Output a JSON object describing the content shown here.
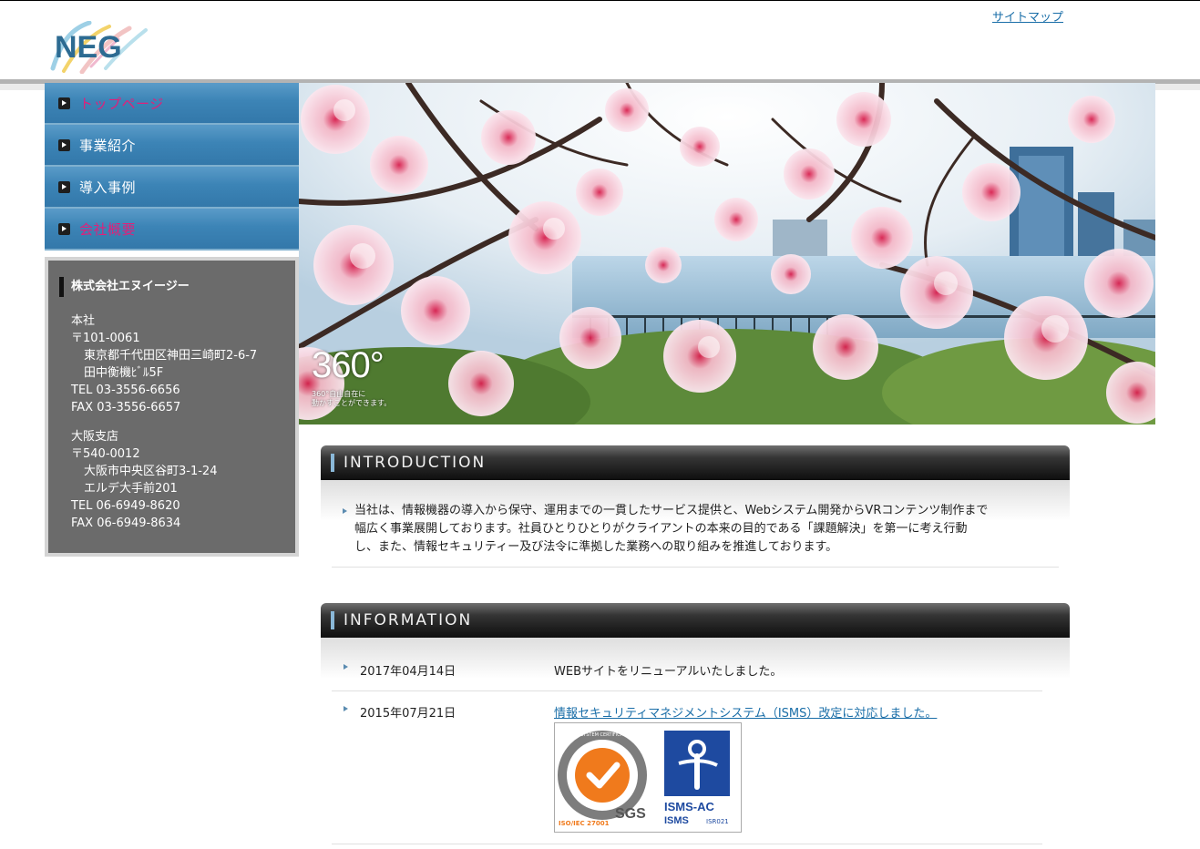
{
  "header": {
    "logo_text": "NEG",
    "sitemap_label": "サイトマップ"
  },
  "nav": {
    "items": [
      {
        "label": "トップページ"
      },
      {
        "label": "事業紹介"
      },
      {
        "label": "導入事例"
      },
      {
        "label": "会社概要"
      }
    ]
  },
  "company": {
    "name": "株式会社エヌイージー",
    "hq": {
      "title": "本社",
      "zip": "〒101-0061",
      "addr1": "東京都千代田区神田三崎町2-6-7",
      "addr2": "田中衡機ﾋﾞﾙ5F",
      "tel": "TEL 03-3556-6656",
      "fax": "FAX 03-3556-6657"
    },
    "osaka": {
      "title": "大阪支店",
      "zip": "〒540-0012",
      "addr1": "大阪市中央区谷町3-1-24",
      "addr2": "エルデ大手前201",
      "tel": "TEL 06-6949-8620",
      "fax": "FAX 06-6949-8634"
    }
  },
  "hero": {
    "badge": "360°",
    "caption_line1": "360°自由自在に",
    "caption_line2": "動かすことができます。"
  },
  "introduction": {
    "heading": "INTRODUCTION",
    "line1": "当社は、情報機器の導入から保守、運用までの一貫したサービス提供と、Webシステム開発からVRコンテンツ制作まで",
    "line2": "幅広く事業展開しております。社員ひとりひとりがクライアントの本来の目的である「課題解決」を第一に考え行動",
    "line3": "し、また、情報セキュリティー及び法令に準拠した業務への取り組みを推進しております。"
  },
  "information": {
    "heading": "INFORMATION",
    "entries": [
      {
        "date": "2017年04月14日",
        "text": "WEBサイトをリニューアルいたしました。"
      },
      {
        "date": "2015年07月21日",
        "text": "情報セキュリティマネジメントシステム（ISMS）改定に対応しました。"
      }
    ]
  },
  "certification": {
    "ring_text": "SYSTEM CERTIFICATION",
    "iso_text": "ISO/IEC 27001",
    "sgs": "SGS",
    "isms_ac": "ISMS-AC",
    "isms": "ISMS",
    "code": "ISR021"
  },
  "colors": {
    "nav_blue": "#3c84b6",
    "nav_active": "#e0207a",
    "link": "#1a6ea8",
    "address_bg": "#6b6b6b"
  }
}
